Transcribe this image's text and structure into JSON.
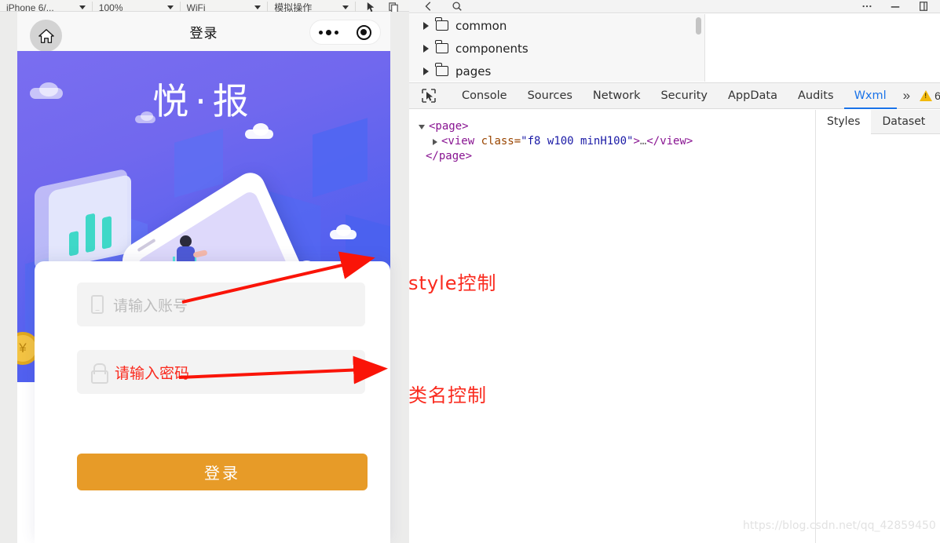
{
  "simulator": {
    "toolbar": {
      "device": "iPhone 6/...",
      "zoom": "100%",
      "network": "WiFi",
      "action": "模拟操作",
      "icons": [
        "cursor-icon",
        "copy-icon"
      ]
    },
    "phone": {
      "home_icon": "home-icon",
      "title": "登录",
      "capsule": {
        "more_icon": "more-dots-icon",
        "target_icon": "target-icon"
      }
    },
    "banner": {
      "title": "悦·报",
      "illustration": "isometric-phone-person-illustration",
      "gradient_from": "#7a6ef0",
      "gradient_to": "#4064f0"
    },
    "login": {
      "account_placeholder": "请输入账号",
      "account_icon": "phone-icon",
      "account_color": "#bdbdbd",
      "password_placeholder": "请输入密码",
      "password_icon": "lock-icon",
      "password_color": "#fa2a1e",
      "submit_label": "登录",
      "submit_color": "#e79b28"
    }
  },
  "devtools": {
    "toolbar": {
      "back_icon": "back-icon",
      "search_icon": "search-icon",
      "more_icon": "more-icon",
      "minimize_icon": "minimize-icon",
      "dock_icon": "dock-icon"
    },
    "file_tree": [
      {
        "label": "common",
        "icon": "folder-icon",
        "expanded": false
      },
      {
        "label": "components",
        "icon": "folder-icon",
        "expanded": false
      },
      {
        "label": "pages",
        "icon": "folder-icon",
        "expanded": false
      }
    ],
    "tabs": [
      {
        "label": "Console",
        "active": false
      },
      {
        "label": "Sources",
        "active": false
      },
      {
        "label": "Network",
        "active": false
      },
      {
        "label": "Security",
        "active": false
      },
      {
        "label": "AppData",
        "active": false
      },
      {
        "label": "Audits",
        "active": false
      },
      {
        "label": "Wxml",
        "active": true
      }
    ],
    "tab_overflow": "»",
    "warning_count": "6",
    "inspect_icon": "inspect-cursor-icon",
    "wxml": {
      "line1_tag": "<page>",
      "line2_open": "<view",
      "line2_attr": "class=",
      "line2_value": "\"f8 w100 minH100\"",
      "line2_gt": ">",
      "line2_ellipsis": "…",
      "line2_close": "</view>",
      "line3_tag": "</page>"
    },
    "styles_tabs": [
      {
        "label": "Styles",
        "active": true
      },
      {
        "label": "Dataset",
        "active": false
      }
    ]
  },
  "annotations": {
    "style_note": "style控制",
    "class_note": "类名控制",
    "arrow_color": "#fa1408"
  },
  "watermark": "https://blog.csdn.net/qq_42859450"
}
